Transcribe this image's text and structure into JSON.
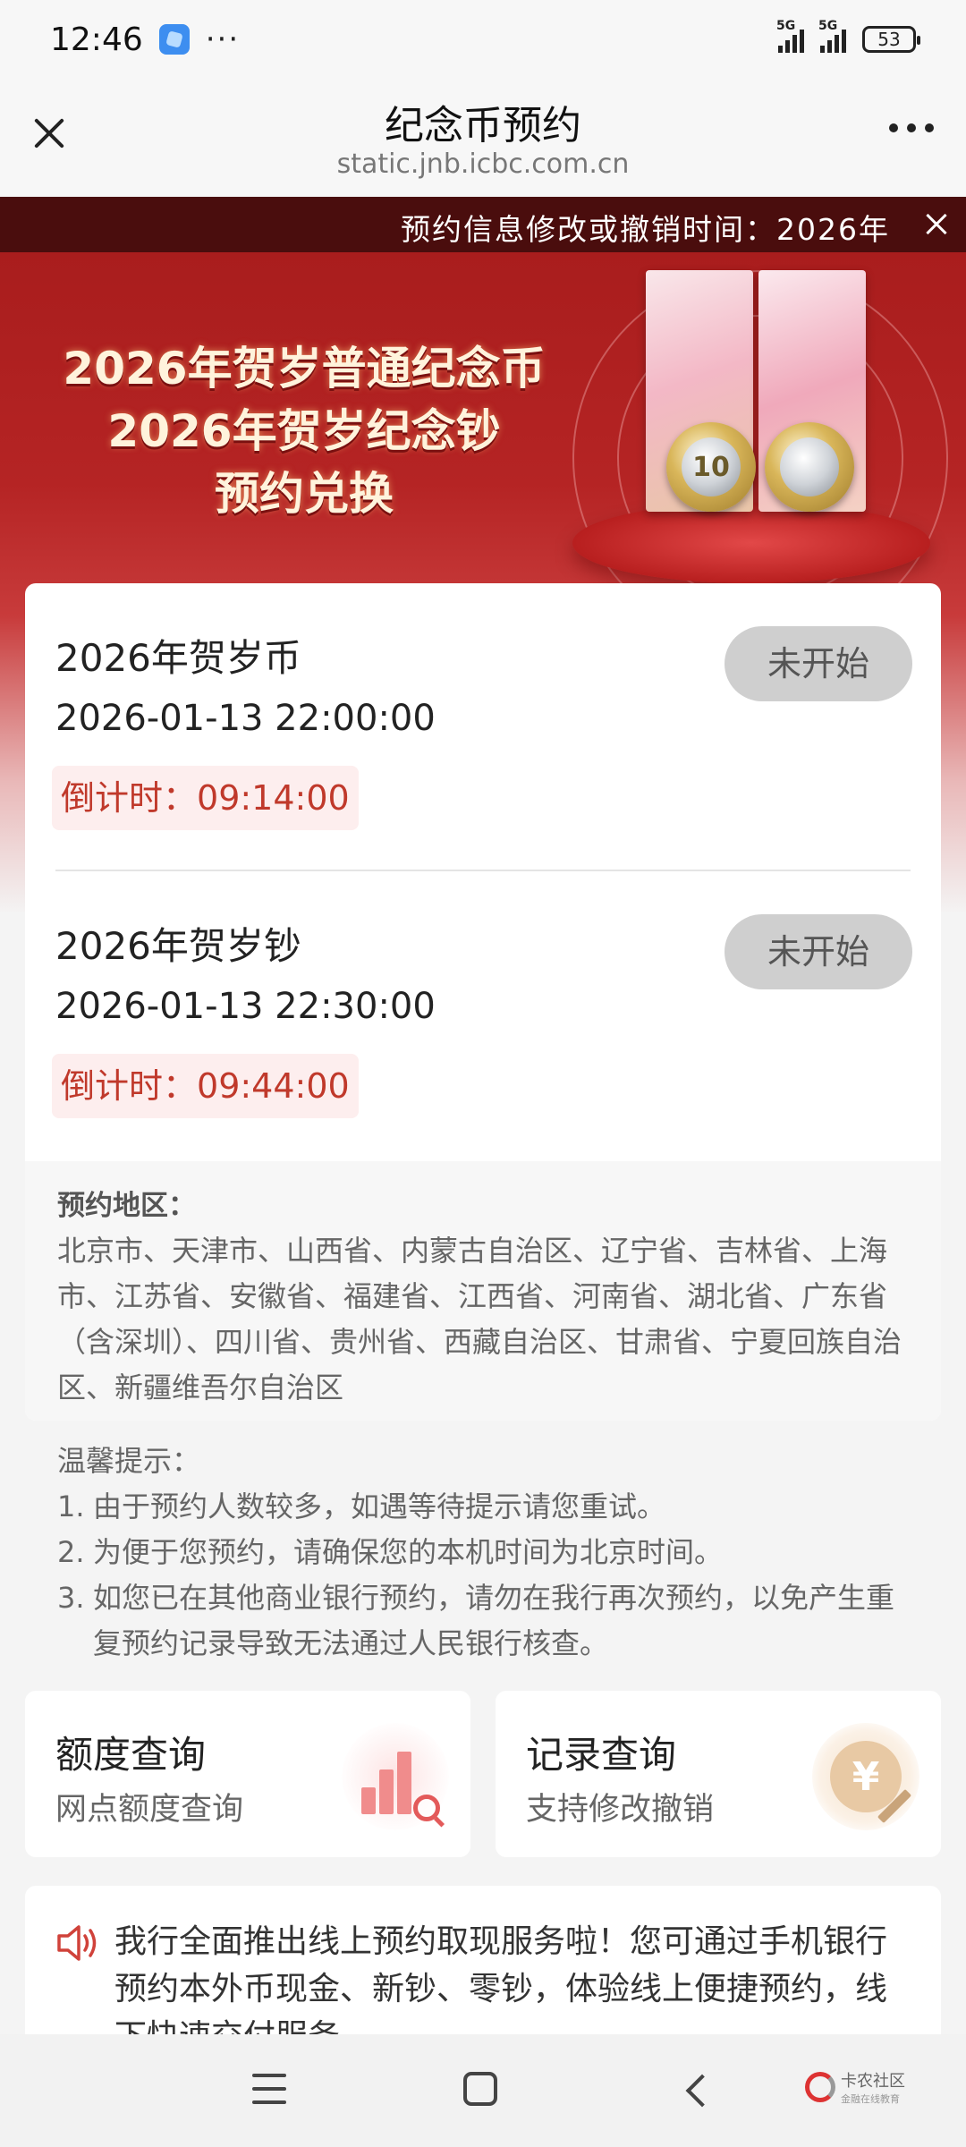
{
  "status_bar": {
    "time": "12:46",
    "dots": "···",
    "network1": "5G",
    "network2": "5G",
    "battery": "53"
  },
  "title_bar": {
    "title": "纪念币预约",
    "url": "static.jnb.icbc.com.cn"
  },
  "notice": {
    "text": "预约信息修改或撤销时间：2026年"
  },
  "banner": {
    "line1": "2026年贺岁普通纪念币",
    "line2": "2026年贺岁纪念钞",
    "line3": "预约兑换",
    "coin_value": "10"
  },
  "items": [
    {
      "title": "2026年贺岁币",
      "time": "2026-01-13 22:00:00",
      "countdown_label": "倒计时：",
      "countdown_value": "09:14:00",
      "status": "未开始"
    },
    {
      "title": "2026年贺岁钞",
      "time": "2026-01-13 22:30:00",
      "countdown_label": "倒计时：",
      "countdown_value": "09:44:00",
      "status": "未开始"
    }
  ],
  "region": {
    "label": "预约地区：",
    "text": "北京市、天津市、山西省、内蒙古自治区、辽宁省、吉林省、上海市、江苏省、安徽省、福建省、江西省、河南省、湖北省、广东省（含深圳）、四川省、贵州省、西藏自治区、甘肃省、宁夏回族自治区、新疆维吾尔自治区"
  },
  "tips": {
    "heading": "温馨提示：",
    "items": [
      {
        "num": "1.",
        "text": "由于预约人数较多，如遇等待提示请您重试。"
      },
      {
        "num": "2.",
        "text": "为便于您预约，请确保您的本机时间为北京时间。"
      },
      {
        "num": "3.",
        "text": "如您已在其他商业银行预约，请勿在我行再次预约，以免产生重复预约记录导致无法通过人民银行核查。"
      }
    ]
  },
  "quick_cards": [
    {
      "title": "额度查询",
      "subtitle": "网点额度查询"
    },
    {
      "title": "记录查询",
      "subtitle": "支持修改撤销",
      "icon_text": "¥"
    }
  ],
  "promo": {
    "text": "我行全面推出线上预约取现服务啦！您可通过手机银行预约本外币现金、新钞、零钞，体验线上便捷预约，线下快速交付服务。"
  },
  "watermark": {
    "main": "卡农社区",
    "sub": "金融在线教育"
  },
  "colors": {
    "accent_red": "#c0392b",
    "banner_red": "#b52424",
    "notice_bg": "#4a0d0d",
    "button_grey": "#cfcfcf"
  }
}
